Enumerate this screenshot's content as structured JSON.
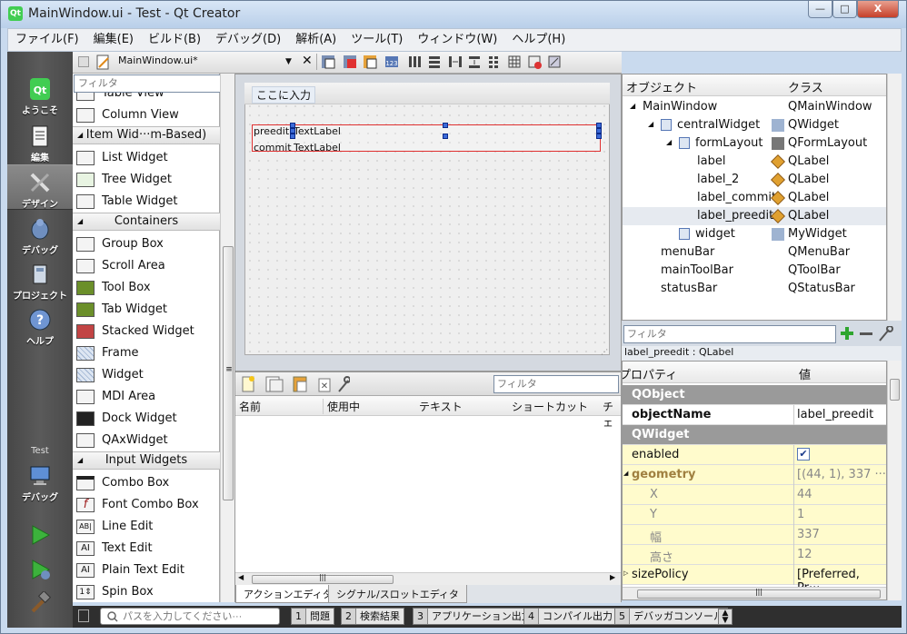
{
  "window": {
    "title": "MainWindow.ui - Test - Qt Creator",
    "logo": "Qt",
    "buttons": {
      "minimize": "—",
      "maximize": "□",
      "close": "X"
    }
  },
  "menu": [
    "ファイル(F)",
    "編集(E)",
    "ビルド(B)",
    "デバッグ(D)",
    "解析(A)",
    "ツール(T)",
    "ウィンドウ(W)",
    "ヘルプ(H)"
  ],
  "modes": [
    {
      "label": "ようこそ",
      "icon": "qt-logo-icon"
    },
    {
      "label": "編集",
      "icon": "edit-document-icon"
    },
    {
      "label": "デザイン",
      "icon": "design-pen-icon"
    },
    {
      "label": "デバッグ",
      "icon": "debug-bug-icon"
    },
    {
      "label": "プロジェクト",
      "icon": "project-wrench-icon"
    },
    {
      "label": "ヘルプ",
      "icon": "help-icon"
    }
  ],
  "kit": {
    "name": "Test",
    "mode": "デバッグ"
  },
  "editor": {
    "document": "MainWindow.ui*"
  },
  "widgetbox": {
    "filter_placeholder": "フィルタ",
    "items": [
      {
        "label": "Table View"
      },
      {
        "label": "Column View"
      },
      {
        "label": "Item Wid···m-Based)",
        "category": true
      },
      {
        "label": "List Widget"
      },
      {
        "label": "Tree Widget"
      },
      {
        "label": "Table Widget"
      },
      {
        "label": "Containers",
        "category": true
      },
      {
        "label": "Group Box"
      },
      {
        "label": "Scroll Area"
      },
      {
        "label": "Tool Box"
      },
      {
        "label": "Tab Widget"
      },
      {
        "label": "Stacked Widget"
      },
      {
        "label": "Frame"
      },
      {
        "label": "Widget"
      },
      {
        "label": "MDI Area"
      },
      {
        "label": "Dock Widget"
      },
      {
        "label": "QAxWidget"
      },
      {
        "label": "Input Widgets",
        "category": true
      },
      {
        "label": "Combo Box"
      },
      {
        "label": "Font Combo Box"
      },
      {
        "label": "Line Edit"
      },
      {
        "label": "Text Edit"
      },
      {
        "label": "Plain Text Edit"
      },
      {
        "label": "Spin Box"
      }
    ]
  },
  "form": {
    "menu_placeholder": "ここに入力",
    "rows": [
      {
        "label": "preedit",
        "value": "TextLabel"
      },
      {
        "label": "commit",
        "value": "TextLabel"
      }
    ]
  },
  "action_editor": {
    "filter_placeholder": "フィルタ",
    "columns": [
      "名前",
      "使用中",
      "テキスト",
      "ショートカット",
      "チェ"
    ],
    "tabs": [
      "アクションエディタ",
      "シグナル/スロットエディタ"
    ]
  },
  "object_inspector": {
    "headers": [
      "オブジェクト",
      "クラス"
    ],
    "rows": [
      {
        "name": "MainWindow",
        "class": "QMainWindow",
        "indent": 0,
        "expander": "◢"
      },
      {
        "name": "centralWidget",
        "class": "QWidget",
        "indent": 1,
        "expander": "◢"
      },
      {
        "name": "formLayout",
        "class": "QFormLayout",
        "indent": 2,
        "expander": "◢"
      },
      {
        "name": "label",
        "class": "QLabel",
        "indent": 3
      },
      {
        "name": "label_2",
        "class": "QLabel",
        "indent": 3
      },
      {
        "name": "label_commit",
        "class": "QLabel",
        "indent": 3
      },
      {
        "name": "label_preedit",
        "class": "QLabel",
        "indent": 3,
        "selected": true
      },
      {
        "name": "widget",
        "class": "MyWidget",
        "indent": 2
      },
      {
        "name": "menuBar",
        "class": "QMenuBar",
        "indent": 1
      },
      {
        "name": "mainToolBar",
        "class": "QToolBar",
        "indent": 1
      },
      {
        "name": "statusBar",
        "class": "QStatusBar",
        "indent": 1
      }
    ]
  },
  "property_editor": {
    "filter_placeholder": "フィルタ",
    "selection": "label_preedit : QLabel",
    "headers": [
      "プロパティ",
      "値"
    ],
    "rows": [
      {
        "key": "QObject",
        "value": "",
        "group": true
      },
      {
        "key": "objectName",
        "value": "label_preedit",
        "bold": true
      },
      {
        "key": "QWidget",
        "value": "",
        "group": true
      },
      {
        "key": "enabled",
        "value": "✔",
        "yellow": true
      },
      {
        "key": "geometry",
        "value": "[(44, 1), 337 ···",
        "yellow": true,
        "expander": "◢"
      },
      {
        "key": "X",
        "value": "44",
        "yellow": true,
        "sub": true
      },
      {
        "key": "Y",
        "value": "1",
        "yellow": true,
        "sub": true
      },
      {
        "key": "幅",
        "value": "337",
        "yellow": true,
        "sub": true
      },
      {
        "key": "高さ",
        "value": "12",
        "yellow": true,
        "sub": true
      },
      {
        "key": "sizePolicy",
        "value": "[Preferred, Pr···",
        "yellow": true,
        "expander": "▷"
      }
    ]
  },
  "statusbar": {
    "search_placeholder": "パスを入力してください···",
    "panes": [
      {
        "num": "1",
        "label": "問題"
      },
      {
        "num": "2",
        "label": "検索結果"
      },
      {
        "num": "3",
        "label": "アプリケーション出力"
      },
      {
        "num": "4",
        "label": "コンパイル出力"
      },
      {
        "num": "5",
        "label": "デバッガコンソール"
      }
    ]
  },
  "scroll_glyphs": {
    "left": "◀",
    "right": "▶",
    "up": "▲",
    "down": "▼",
    "grip": "≡",
    "grip_h": "|||"
  }
}
